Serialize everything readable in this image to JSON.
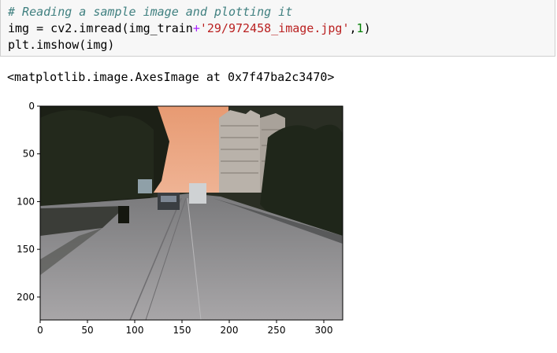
{
  "code_cell": {
    "comment": "# Reading a sample image and plotting it",
    "line2": {
      "prefix": "img = cv2.imread(img_train",
      "op": "+",
      "str": "'29/972458_image.jpg'",
      "sep": ",",
      "num": "1",
      "suffix": ")"
    },
    "line3": "plt.imshow(img)"
  },
  "output": {
    "repr": "<matplotlib.image.AxesImage at 0x7f47ba2c3470>"
  },
  "chart_data": {
    "type": "image",
    "xlim": [
      0,
      320
    ],
    "ylim": [
      224,
      0
    ],
    "x_ticks": [
      "0",
      "50",
      "100",
      "150",
      "200",
      "250",
      "300"
    ],
    "y_ticks": [
      "0",
      "50",
      "100",
      "150",
      "200"
    ],
    "image_content": "street scene with road, trees, cars and tall buildings under orange sky",
    "colors": {
      "sky": "#e6a07c",
      "road": "#8f8f8f",
      "trees": "#1e2418"
    }
  }
}
